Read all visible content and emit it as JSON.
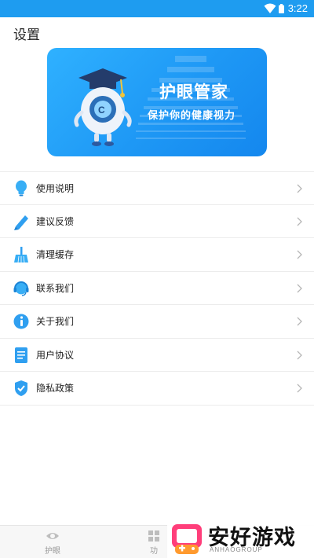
{
  "status_bar": {
    "time": "3:22",
    "icons": [
      "wifi-icon",
      "battery-icon"
    ]
  },
  "page": {
    "title": "设置"
  },
  "banner": {
    "title": "护眼管家",
    "subtitle": "保护你的健康视力"
  },
  "menu": {
    "items": [
      {
        "label": "使用说明",
        "icon": "lightbulb-icon"
      },
      {
        "label": "建议反馈",
        "icon": "pencil-icon"
      },
      {
        "label": "清理缓存",
        "icon": "broom-icon"
      },
      {
        "label": "联系我们",
        "icon": "headset-icon"
      },
      {
        "label": "关于我们",
        "icon": "info-icon"
      },
      {
        "label": "用户协议",
        "icon": "document-icon"
      },
      {
        "label": "隐私政策",
        "icon": "shield-check-icon"
      }
    ]
  },
  "tabbar": {
    "tabs": [
      {
        "label": "护眼",
        "icon": "eye-icon"
      },
      {
        "label": "功",
        "icon": "grid-icon"
      }
    ]
  },
  "watermark": {
    "text": "安好游戏",
    "subtext": "ANHAOGROUP"
  },
  "colors": {
    "accent": "#1e9cf0",
    "banner_start": "#2fb1ff",
    "banner_end": "#1487ee"
  }
}
